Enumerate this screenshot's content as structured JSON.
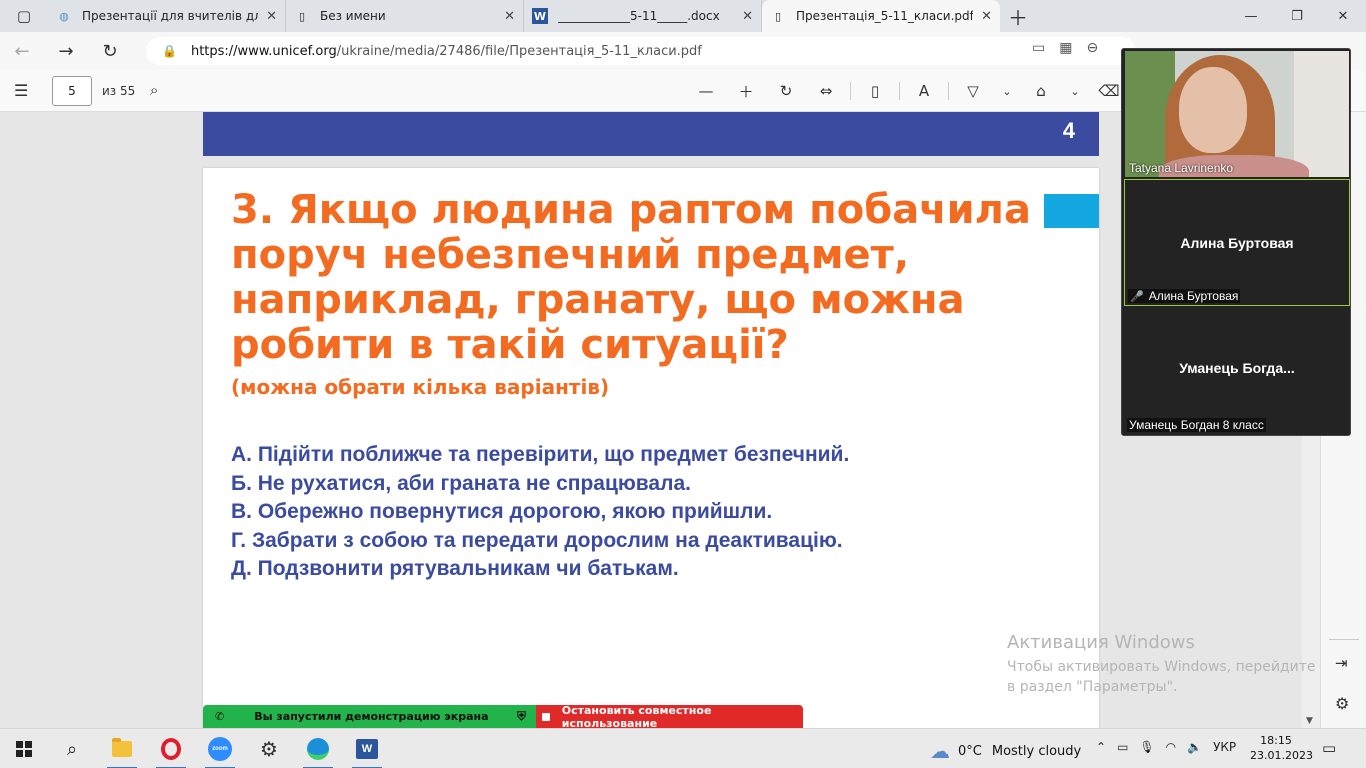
{
  "browser": {
    "tabs": [
      {
        "label": "Презентації для вчителів для пр",
        "icon": "globe-icon",
        "icon_glyph": "◍",
        "width": 238
      },
      {
        "label": "Без имени",
        "icon": "document-icon",
        "icon_glyph": "▯",
        "width": 238
      },
      {
        "label": "____________5-11_____.docx",
        "icon": "word-icon",
        "icon_glyph": "W",
        "width": 238
      },
      {
        "label": "Презентація_5-11_класи.pdf",
        "icon": "pdf-icon",
        "icon_glyph": "▯",
        "width": 238,
        "active": true
      }
    ],
    "url_host": "https://www.unicef.org",
    "url_path": "/ukraine/media/27486/file/Презентація_5-11_класи.pdf"
  },
  "pdf_toolbar": {
    "page_current": "5",
    "page_total_label": "из 55"
  },
  "prev_page": {
    "number": "4"
  },
  "slide": {
    "title": "3. Якщо людина раптом побачила поруч небезпечний предмет, наприклад, гранату, що можна робити в такій ситуації?",
    "subtitle": "(можна обрати кілька варіантів)",
    "answers": [
      "А. Підійти поближче та перевірити, що предмет безпечний.",
      "Б. Не рухатися, аби граната не спрацювала.",
      "В. Обережно повернутися дорогою, якою прийшли.",
      "Г.  Забрати з собою та передати дорослим на деактивацію.",
      "Д. Подзвонити рятувальникам чи батькам."
    ]
  },
  "watermark": {
    "heading": "Активация Windows",
    "text": "Чтобы активировать Windows, перейдите в раздел \"Параметры\"."
  },
  "share_bar": {
    "status": "Вы запустили демонстрацию экрана",
    "stop": "Остановить совместное использование"
  },
  "call": {
    "self_name": "Tatyana Lavrinenko",
    "participants": [
      {
        "display": "Алина Буртовая",
        "label": "Алина Буртовая",
        "muted": true
      },
      {
        "display": "Уманець  Богда...",
        "label": "Уманець Богдан 8 класс",
        "muted": false
      }
    ]
  },
  "taskbar": {
    "weather_temp": "0°C",
    "weather_desc": "Mostly cloudy",
    "language": "УКР",
    "time": "18:15",
    "date": "23.01.2023"
  },
  "colors": {
    "title_orange": "#f26b21",
    "answer_blue": "#3a4ba0",
    "band_blue": "#3a4ba0",
    "accent_cyan": "#14a8e0",
    "share_green": "#23b34b",
    "share_red": "#e02a2a"
  }
}
